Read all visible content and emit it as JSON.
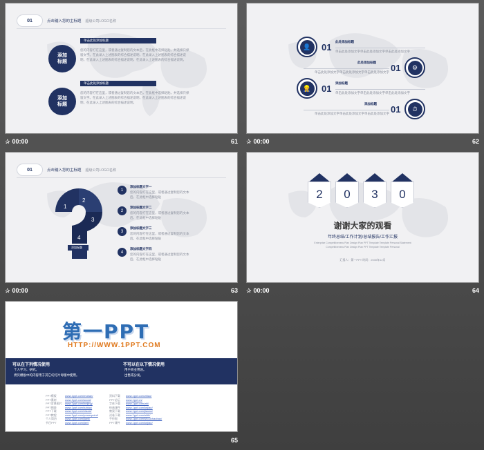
{
  "slides": [
    {
      "number": "61",
      "time": "00:00",
      "header": {
        "num": "01",
        "title": "点击输入您的主标题",
        "sub": "超级公司LOGO名称"
      },
      "items": [
        {
          "bubble": "添加\n标题",
          "tag": "单击此处添加标题",
          "text": "您的内容打在这里，或者通过复制您的文本后，在此框中选择粘贴，并选择只保留文字。在此录入上述图表的综合描述说明，在此录入上述图表的综合描述说明，在此录入上述图表的综合描述说明。在此录入上述图表的综合描述说明。"
        },
        {
          "bubble": "添加\n标题",
          "tag": "单击此处添加标题",
          "text": "您的内容打在这里，或者通过复制您的文本后，在此框中选择粘贴，并选择只保留文字。在此录入上述图表的综合描述说明，在此录入上述图表的综合描述说明，在此录入上述图表的综合描述说明。"
        }
      ]
    },
    {
      "number": "62",
      "time": "00:00",
      "items": [
        {
          "num": "01",
          "title": "此处添加标题",
          "text": "单击此处添加文字单击此处添加文字单击此处添加文字"
        },
        {
          "num": "01",
          "title": "此处添加标题",
          "text": "单击此处添加文字单击此处添加文字单击此处添加文字"
        },
        {
          "num": "01",
          "title": "添加标题",
          "text": "单击此处添加文字单击此处添加文字单击此处添加文字"
        },
        {
          "num": "01",
          "title": "添加标题",
          "text": "单击此处添加文字单击此处添加文字单击此处添加文字"
        }
      ]
    },
    {
      "number": "63",
      "time": "00:00",
      "header": {
        "num": "01",
        "title": "点击输入您的主标题",
        "sub": "超级公司LOGO名称"
      },
      "qlabels": [
        "1",
        "2",
        "3",
        "4"
      ],
      "qtag": "添加标题",
      "items": [
        {
          "n": "1",
          "title": "添加标题文字一",
          "text": "您的内容打在这里，或者通过复制您的文本后，在此框中选择粘贴"
        },
        {
          "n": "2",
          "title": "添加标题文字二",
          "text": "您的内容打在这里，或者通过复制您的文本后，在此框中选择粘贴"
        },
        {
          "n": "3",
          "title": "添加标题文字三",
          "text": "您的内容打在这里，或者通过复制您的文本后，在此框中选择粘贴"
        },
        {
          "n": "4",
          "title": "添加标题文字四",
          "text": "您的内容打在这里，或者通过复制您的文本后，在此框中选择粘贴"
        }
      ]
    },
    {
      "number": "64",
      "time": "00:00",
      "digits": [
        "2",
        "0",
        "3",
        "0"
      ],
      "title": "谢谢大家的观看",
      "subtitle": "年终总结/工作计划/总结报告/工作汇报",
      "small1": "Enterprise Competitiveness   Plan Design   Plan PPT Template   Template Personal Statement",
      "small2": "Competitiveness   Plan Design   Plan PPT Template   Template Personal",
      "footer": "汇报人：第一PPT         时间：2030年12月"
    },
    {
      "number": "65",
      "logo_cn": "第一PPT",
      "logo_url": "HTTP://WWW.1PPT.COM",
      "left_title": "可以在下列情况使用",
      "left_items": [
        "个人学习、研究。",
        "拷贝模板中的内容用于其它幻灯片母版中使用。"
      ],
      "right_title": "不可以在以下情况使用",
      "right_items": [
        "用于商业用途。",
        "出售或分发。"
      ],
      "links_left": [
        [
          "PPT模板",
          "www.1ppt.com/moban/"
        ],
        [
          "PPT素材",
          "www.1ppt.com/sucai/"
        ],
        [
          "PPT背景图片",
          "www.1ppt.com/beijing/"
        ],
        [
          "PPT图表",
          "www.1ppt.com/tubiao/"
        ],
        [
          "PPT下载",
          "www.1ppt.com/xiazai/"
        ],
        [
          "PPT教程",
          "www.1ppt.com/powerpoint/"
        ],
        [
          "个人简历",
          "www.1ppt.com/jianli/"
        ],
        [
          "节日PPT",
          "www.1ppt.com/jieri/"
        ]
      ],
      "links_right": [
        [
          "资料下载",
          "www.1ppt.com/ziliao/"
        ],
        [
          "PPT论坛",
          "www.1ppt.cn/"
        ],
        [
          "字体下载",
          "www.1ppt.com/ziti/"
        ],
        [
          "绘画课件",
          "www.1ppt.com/kejian/"
        ],
        [
          "教案下载",
          "www.1ppt.com/jiaoan/"
        ],
        [
          "试卷下载",
          "www.1ppt.com/shiti/"
        ],
        [
          "手抄报",
          "www.1ppt.com/shouchaobao/"
        ],
        [
          "PPT课件",
          "www.1ppt.com/kejian/"
        ]
      ]
    }
  ]
}
